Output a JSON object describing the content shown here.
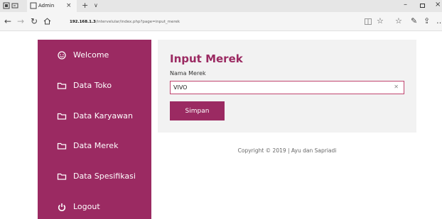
{
  "browser": {
    "tab_title": "Admin",
    "url_host": "192.168.1.3",
    "url_path": "/intervelular/index.php?page=input_merek"
  },
  "sidebar": {
    "items": [
      {
        "label": "Welcome",
        "icon": "smile-icon"
      },
      {
        "label": "Data Toko",
        "icon": "folder-icon"
      },
      {
        "label": "Data Karyawan",
        "icon": "folder-icon"
      },
      {
        "label": "Data Merek",
        "icon": "folder-icon"
      },
      {
        "label": "Data Spesifikasi",
        "icon": "folder-icon"
      },
      {
        "label": "Logout",
        "icon": "power-icon"
      }
    ]
  },
  "form": {
    "title": "Input Merek",
    "field_label": "Nama Merek",
    "field_value": "VIVO",
    "submit_label": "Simpan"
  },
  "footer": {
    "text": "Copyright © 2019 | Ayu dan Sapriadi"
  },
  "colors": {
    "accent": "#9b2a62",
    "panel_bg": "#f2f2f2"
  }
}
